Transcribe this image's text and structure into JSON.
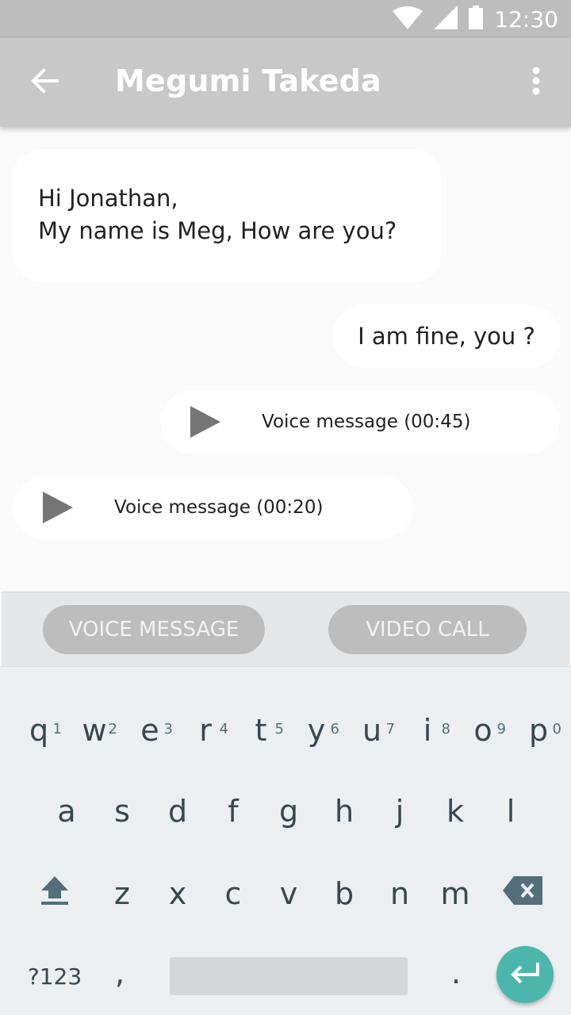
{
  "status_bar": {
    "time": "12:30",
    "icons": [
      "wifi-icon",
      "cell-signal-icon",
      "battery-icon"
    ]
  },
  "app_bar": {
    "title": "Megumi Takeda",
    "back_icon": "arrow-back-icon",
    "menu_icon": "more-vert-icon"
  },
  "messages": [
    {
      "type": "text",
      "side": "incoming",
      "lines": [
        "Hi Jonathan,",
        "My name is Meg, How are you?"
      ]
    },
    {
      "type": "text",
      "side": "outgoing",
      "text": "I am fine, you ?"
    },
    {
      "type": "voice",
      "side": "outgoing",
      "label": "Voice message (00:45)"
    },
    {
      "type": "voice",
      "side": "incoming",
      "label": "Voice message (00:20)"
    }
  ],
  "actions": {
    "voice_label": "VOICE MESSAGE",
    "video_label": "VIDEO CALL"
  },
  "keyboard": {
    "row1": [
      {
        "key": "q",
        "hint": "1"
      },
      {
        "key": "w",
        "hint": "2"
      },
      {
        "key": "e",
        "hint": "3"
      },
      {
        "key": "r",
        "hint": "4"
      },
      {
        "key": "t",
        "hint": "5"
      },
      {
        "key": "y",
        "hint": "6"
      },
      {
        "key": "u",
        "hint": "7"
      },
      {
        "key": "i",
        "hint": "8"
      },
      {
        "key": "o",
        "hint": "9"
      },
      {
        "key": "p",
        "hint": "0"
      }
    ],
    "row2": [
      "a",
      "s",
      "d",
      "f",
      "g",
      "h",
      "j",
      "k",
      "l"
    ],
    "row3": [
      "z",
      "x",
      "c",
      "v",
      "b",
      "n",
      "m"
    ],
    "symbols_label": "?123",
    "comma": ",",
    "period": "."
  },
  "colors": {
    "accent": "#4db6ac",
    "app_bar": "#c8c8c8",
    "status_bar": "#bdbdbd",
    "pill": "#bdbdbd"
  }
}
